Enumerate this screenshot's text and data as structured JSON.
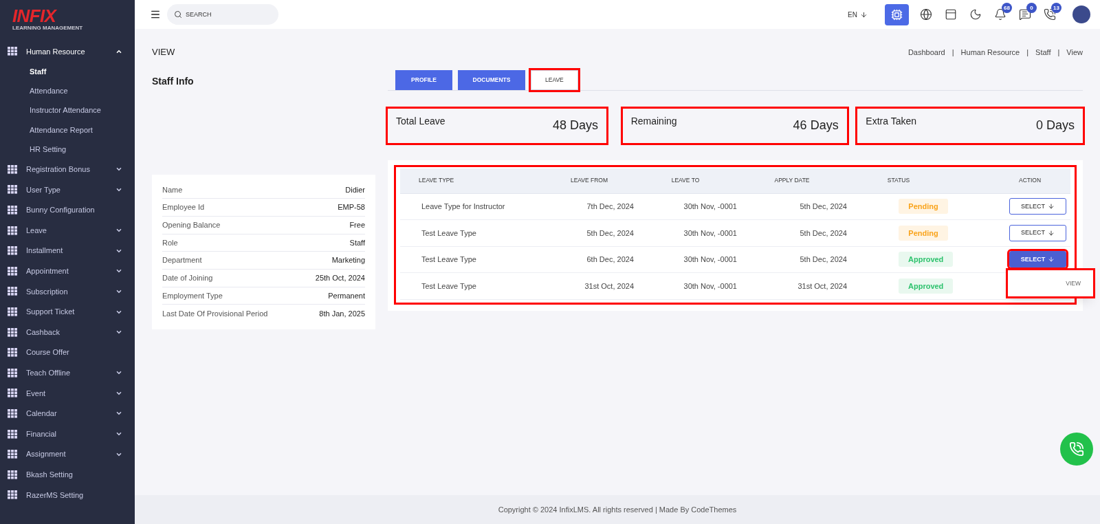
{
  "logo": {
    "title": "INFIX",
    "subtitle": "LEARNING MANAGEMENT"
  },
  "sidebar": {
    "items": [
      {
        "label": "Human Resource",
        "expandable": true,
        "expanded": true,
        "children": [
          {
            "label": "Staff",
            "selected": true
          },
          {
            "label": "Attendance",
            "selected": false
          },
          {
            "label": "Instructor Attendance",
            "selected": false
          },
          {
            "label": "Attendance Report",
            "selected": false
          },
          {
            "label": "HR Setting",
            "selected": false
          }
        ]
      },
      {
        "label": "Registration Bonus",
        "expandable": true,
        "expanded": false
      },
      {
        "label": "User Type",
        "expandable": true,
        "expanded": false
      },
      {
        "label": "Bunny Configuration",
        "expandable": false,
        "expanded": false
      },
      {
        "label": "Leave",
        "expandable": true,
        "expanded": false
      },
      {
        "label": "Installment",
        "expandable": true,
        "expanded": false
      },
      {
        "label": "Appointment",
        "expandable": true,
        "expanded": false
      },
      {
        "label": "Subscription",
        "expandable": true,
        "expanded": false
      },
      {
        "label": "Support Ticket",
        "expandable": true,
        "expanded": false
      },
      {
        "label": "Cashback",
        "expandable": true,
        "expanded": false
      },
      {
        "label": "Course Offer",
        "expandable": false,
        "expanded": false
      },
      {
        "label": "Teach Offline",
        "expandable": true,
        "expanded": false
      },
      {
        "label": "Event",
        "expandable": true,
        "expanded": false
      },
      {
        "label": "Calendar",
        "expandable": true,
        "expanded": false
      },
      {
        "label": "Financial",
        "expandable": true,
        "expanded": false
      },
      {
        "label": "Assignment",
        "expandable": true,
        "expanded": false
      },
      {
        "label": "Bkash Setting",
        "expandable": false,
        "expanded": false
      },
      {
        "label": "RazerMS Setting",
        "expandable": false,
        "expanded": false
      }
    ]
  },
  "topbar": {
    "search": {
      "placeholder": "SEARCH"
    },
    "language": "EN",
    "badges": {
      "notifications": "68",
      "messages": "0",
      "calls": "13"
    }
  },
  "page_title": "VIEW",
  "breadcrumb": {
    "separator": "|",
    "items": [
      "Dashboard",
      "Human Resource",
      "Staff",
      "View"
    ]
  },
  "section_title": "Staff Info",
  "staff_info": [
    {
      "label": "Name",
      "value": "Didier"
    },
    {
      "label": "Employee Id",
      "value": "EMP-58"
    },
    {
      "label": "Opening Balance",
      "value": "Free"
    },
    {
      "label": "Role",
      "value": "Staff"
    },
    {
      "label": "Department",
      "value": "Marketing"
    },
    {
      "label": "Date of Joining",
      "value": "25th Oct, 2024"
    },
    {
      "label": "Employment Type",
      "value": "Permanent"
    },
    {
      "label": "Last Date Of Provisional Period",
      "value": "8th Jan, 2025"
    }
  ],
  "tabs": [
    {
      "label": "PROFILE",
      "selected": false,
      "highlighted": false
    },
    {
      "label": "DOCUMENTS",
      "selected": false,
      "highlighted": false
    },
    {
      "label": "LEAVE",
      "selected": true,
      "highlighted": true
    }
  ],
  "stats": [
    {
      "label": "Total Leave",
      "value": "48 Days",
      "highlighted": true
    },
    {
      "label": "Remaining",
      "value": "46 Days",
      "highlighted": true
    },
    {
      "label": "Extra Taken",
      "value": "0 Days",
      "highlighted": true
    }
  ],
  "table": {
    "highlighted": true,
    "columns": [
      "LEAVE TYPE",
      "LEAVE FROM",
      "LEAVE TO",
      "APPLY DATE",
      "STATUS",
      "ACTION"
    ],
    "rows": [
      {
        "leave_type": "Leave Type for Instructor",
        "from": "7th Dec, 2024",
        "to": "30th Nov, -0001",
        "applied": "5th Dec, 2024",
        "status": "Pending",
        "kind": "pending",
        "action": {
          "label": "SELECT",
          "open": false,
          "highlighted": false
        }
      },
      {
        "leave_type": "Test Leave Type",
        "from": "5th Dec, 2024",
        "to": "30th Nov, -0001",
        "applied": "5th Dec, 2024",
        "status": "Pending",
        "kind": "pending",
        "action": {
          "label": "SELECT",
          "open": false,
          "highlighted": false
        }
      },
      {
        "leave_type": "Test Leave Type",
        "from": "6th Dec, 2024",
        "to": "30th Nov, -0001",
        "applied": "5th Dec, 2024",
        "status": "Approved",
        "kind": "approved",
        "action": {
          "label": "SELECT",
          "open": true,
          "highlighted": true,
          "menu": [
            {
              "label": "VIEW",
              "highlighted": true
            }
          ]
        }
      },
      {
        "leave_type": "Test Leave Type",
        "from": "31st Oct, 2024",
        "to": "30th Nov, -0001",
        "applied": "31st Oct, 2024",
        "status": "Approved",
        "kind": "approved"
      }
    ]
  },
  "footer": "Copyright © 2024 InfixLMS. All rights reserved | Made By CodeThemes"
}
